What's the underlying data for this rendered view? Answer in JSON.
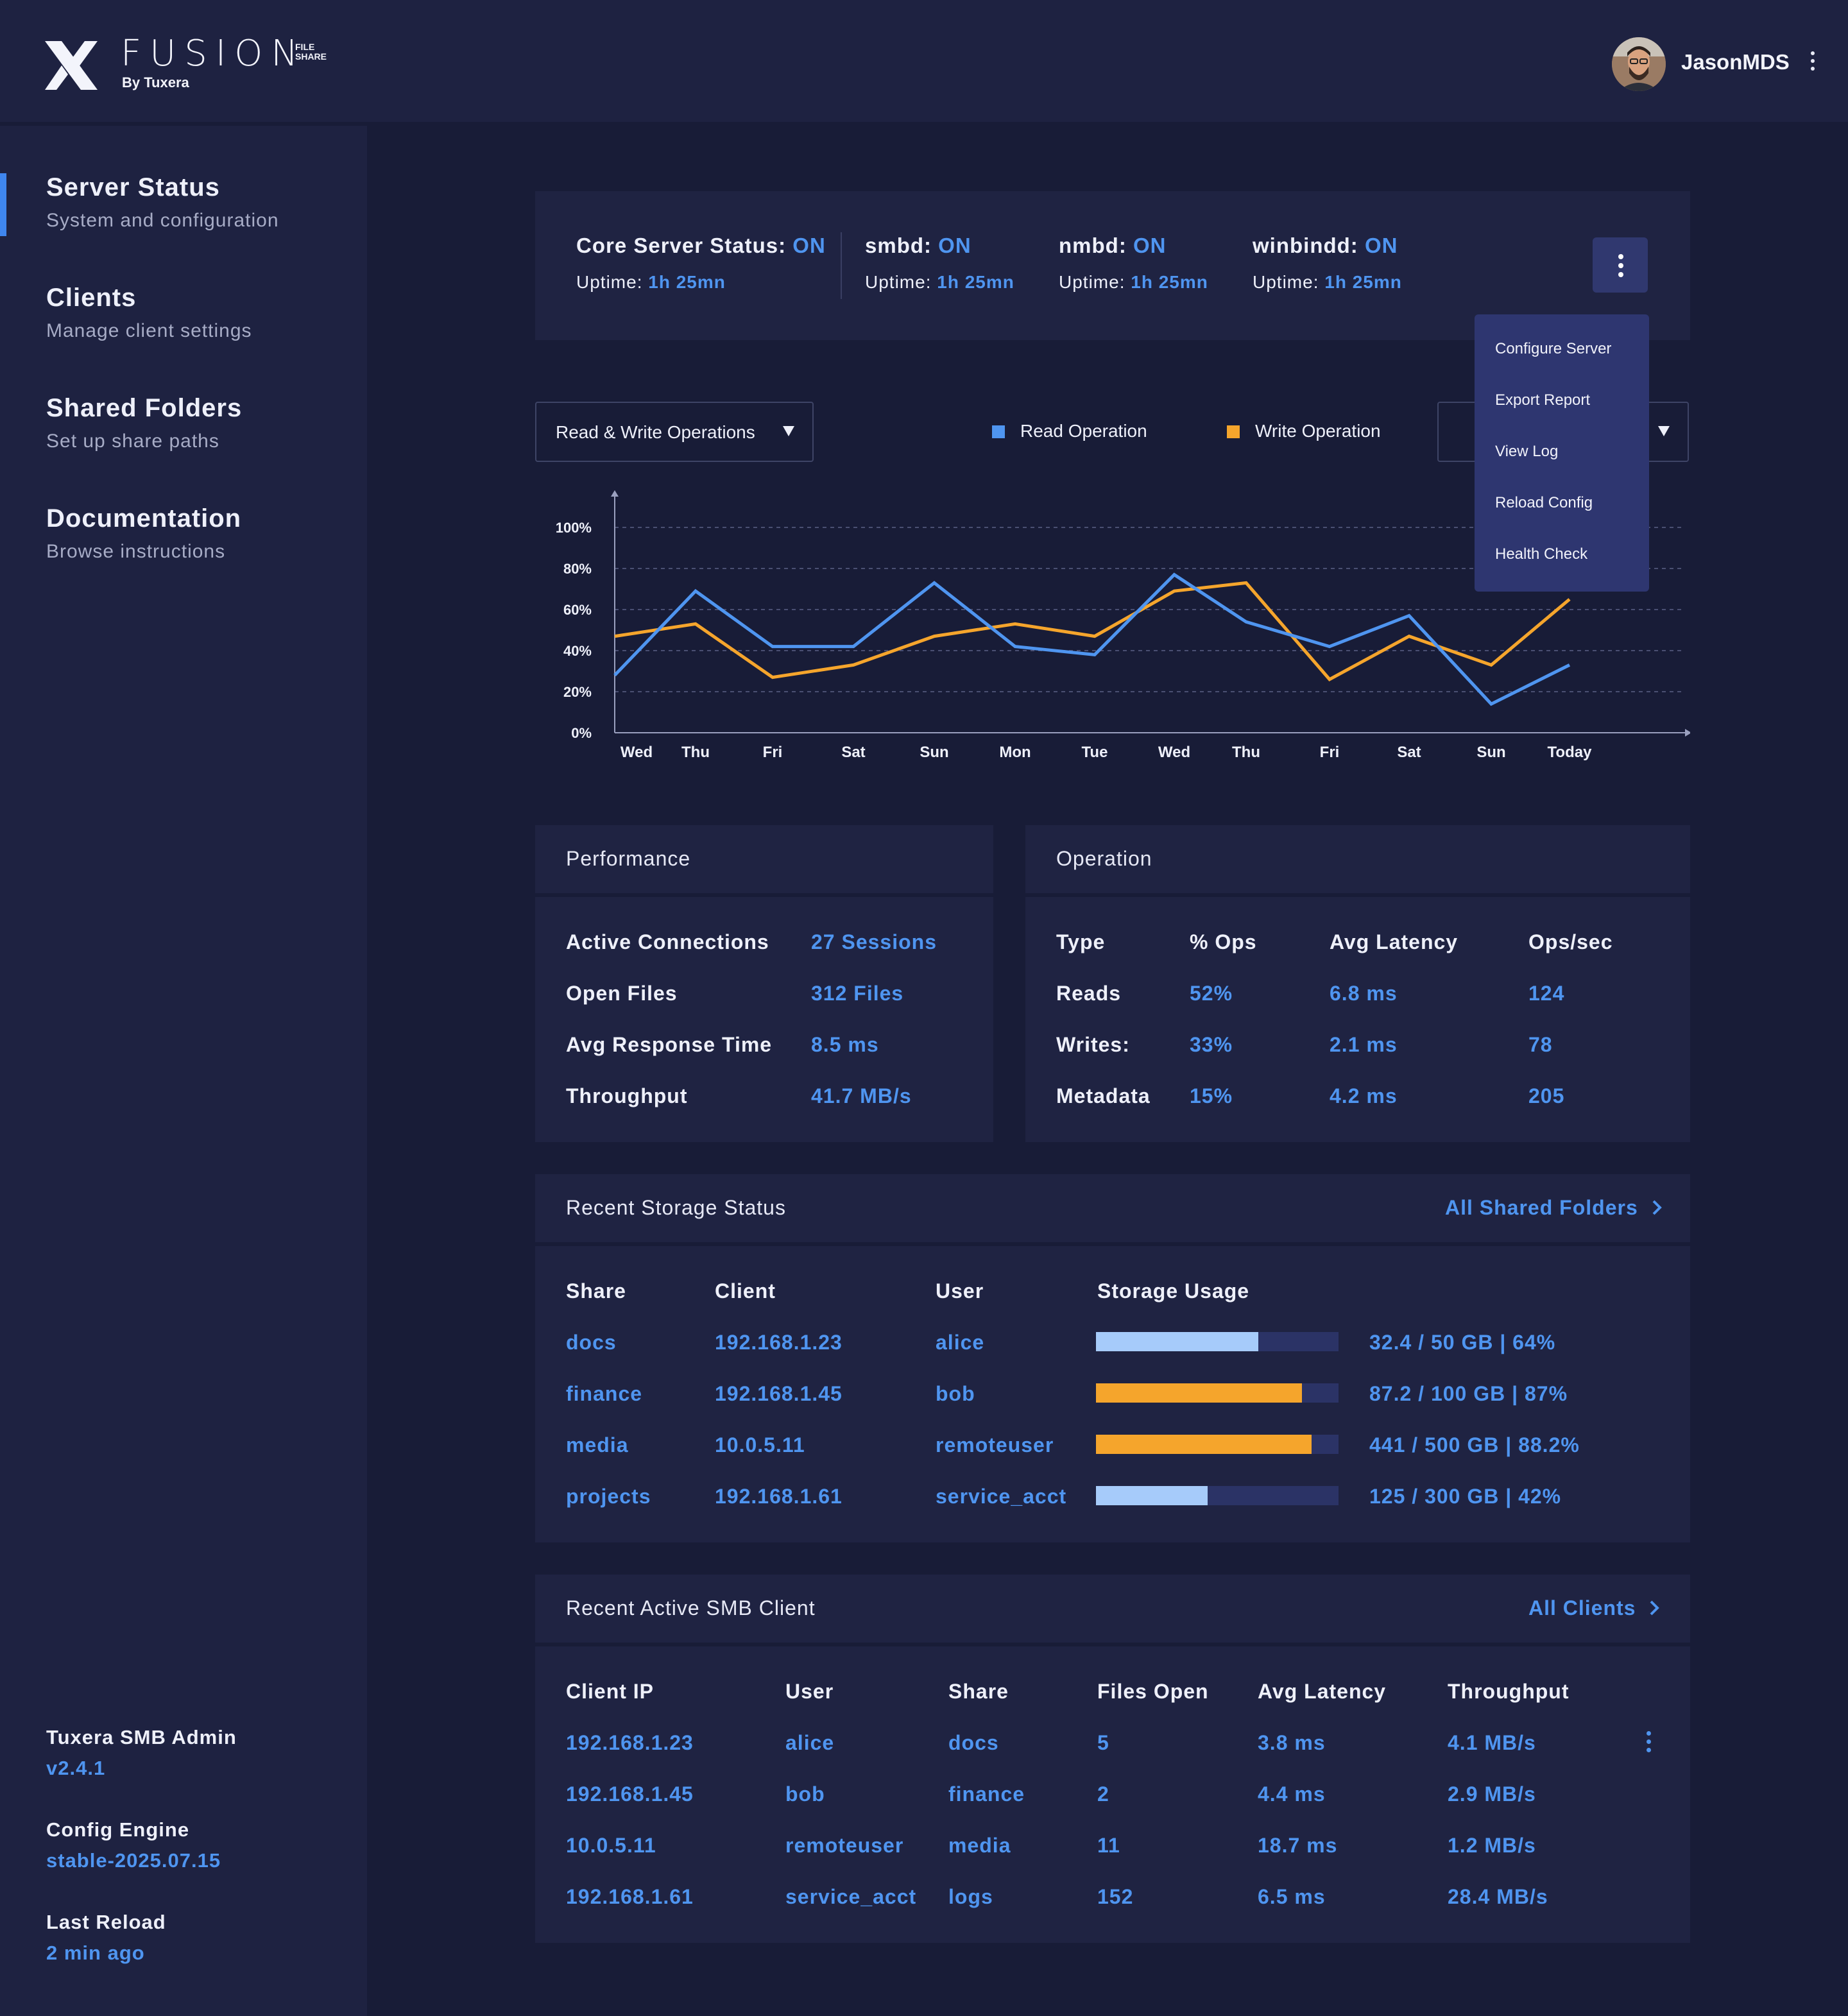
{
  "header": {
    "brand": "FUSION",
    "brand_tag_line1": "FILE",
    "brand_tag_line2": "SHARE",
    "brand_sub": "By Tuxera",
    "username": "JasonMDS"
  },
  "sidebar": {
    "items": [
      {
        "title": "Server Status",
        "subtitle": "System and configuration"
      },
      {
        "title": "Clients",
        "subtitle": "Manage client settings"
      },
      {
        "title": "Shared Folders",
        "subtitle": "Set up share paths"
      },
      {
        "title": "Documentation",
        "subtitle": "Browse instructions"
      }
    ],
    "meta": [
      {
        "label": "Tuxera SMB Admin",
        "value": "v2.4.1"
      },
      {
        "label": "Config Engine",
        "value": "stable-2025.07.15"
      },
      {
        "label": "Last Reload",
        "value": "2 min ago"
      }
    ]
  },
  "status": {
    "items": [
      {
        "name": "Core Server Status:",
        "state": "ON",
        "uptime_label": "Uptime:",
        "uptime": "1h 25mn"
      },
      {
        "name": "smbd:",
        "state": "ON",
        "uptime_label": "Uptime:",
        "uptime": "1h 25mn"
      },
      {
        "name": "nmbd:",
        "state": "ON",
        "uptime_label": "Uptime:",
        "uptime": "1h 25mn"
      },
      {
        "name": "winbindd:",
        "state": "ON",
        "uptime_label": "Uptime:",
        "uptime": "1h 25mn"
      }
    ],
    "menu": [
      "Configure Server",
      "Export Report",
      "View Log",
      "Reload Config",
      "Health Check"
    ]
  },
  "chart_controls": {
    "select_label": "Read & Write Operations",
    "legend_read": "Read Operation",
    "legend_write": "Write Operation"
  },
  "chart_data": {
    "type": "line",
    "categories": [
      "Wed",
      "Thu",
      "Fri",
      "Sat",
      "Sun",
      "Mon",
      "Tue",
      "Wed",
      "Thu",
      "Fri",
      "Sat",
      "Sun",
      "Today"
    ],
    "series": [
      {
        "name": "Read Operation",
        "color": "#4f95f0",
        "points": [
          [
            "Wed-start",
            28
          ],
          [
            "Thu",
            69
          ],
          [
            "Fri",
            42
          ],
          [
            "Sat",
            42
          ],
          [
            "Sun",
            73
          ],
          [
            "Mon",
            42
          ],
          [
            "Tue",
            38
          ],
          [
            "Wed",
            77
          ],
          [
            "Thu",
            54
          ],
          [
            "Fri",
            42
          ],
          [
            "Sat",
            57
          ],
          [
            "Sun",
            14
          ],
          [
            "Today",
            33
          ]
        ]
      },
      {
        "name": "Write Operation",
        "color": "#f5a52c",
        "points": [
          [
            "Wed-start",
            47
          ],
          [
            "Thu",
            53
          ],
          [
            "Fri",
            27
          ],
          [
            "Sat",
            33
          ],
          [
            "Sun",
            47
          ],
          [
            "Mon",
            53
          ],
          [
            "Tue",
            47
          ],
          [
            "Wed",
            69
          ],
          [
            "Thu",
            73
          ],
          [
            "Fri",
            26
          ],
          [
            "Sat",
            47
          ],
          [
            "Sun",
            33
          ],
          [
            "Today",
            65
          ]
        ]
      }
    ],
    "y_ticks": [
      "0%",
      "20%",
      "40%",
      "60%",
      "80%",
      "100%"
    ],
    "ylim": [
      0,
      100
    ],
    "grid": true,
    "legend": "top"
  },
  "performance": {
    "title": "Performance",
    "rows": [
      {
        "label": "Active Connections",
        "value": "27 Sessions"
      },
      {
        "label": "Open Files",
        "value": "312 Files"
      },
      {
        "label": "Avg Response Time",
        "value": "8.5 ms"
      },
      {
        "label": "Throughput",
        "value": "41.7 MB/s"
      }
    ]
  },
  "operation": {
    "title": "Operation",
    "headers": [
      "Type",
      "% Ops",
      "Avg Latency",
      "Ops/sec"
    ],
    "rows": [
      [
        "Reads",
        "52%",
        "6.8 ms",
        "124"
      ],
      [
        "Writes:",
        "33%",
        "2.1 ms",
        "78"
      ],
      [
        "Metadata",
        "15%",
        "4.2 ms",
        "205"
      ]
    ]
  },
  "storage": {
    "title": "Recent Storage Status",
    "link": "All Shared Folders",
    "headers": [
      "Share",
      "Client",
      "User",
      "Storage Usage"
    ],
    "rows": [
      {
        "share": "docs",
        "client": "192.168.1.23",
        "user": "alice",
        "usage": "32.4 / 50 GB | 64%",
        "fraction": 0.67,
        "color": "#a6cbfa"
      },
      {
        "share": "finance",
        "client": "192.168.1.45",
        "user": "bob",
        "usage": "87.2 / 100 GB | 87%",
        "fraction": 0.85,
        "color": "#f5a52c"
      },
      {
        "share": "media",
        "client": "10.0.5.11",
        "user": "remoteuser",
        "usage": "441 / 500 GB | 88.2%",
        "fraction": 0.89,
        "color": "#f5a52c"
      },
      {
        "share": "projects",
        "client": "192.168.1.61",
        "user": "service_acct",
        "usage": "125 / 300 GB | 42%",
        "fraction": 0.46,
        "color": "#a6cbfa"
      }
    ]
  },
  "clients": {
    "title": "Recent Active SMB Client",
    "link": "All Clients",
    "headers": [
      "Client IP",
      "User",
      "Share",
      "Files Open",
      "Avg Latency",
      "Throughput"
    ],
    "rows": [
      [
        "192.168.1.23",
        "alice",
        "docs",
        "5",
        "3.8 ms",
        "4.1 MB/s"
      ],
      [
        "192.168.1.45",
        "bob",
        "finance",
        "2",
        "4.4 ms",
        "2.9 MB/s"
      ],
      [
        "10.0.5.11",
        "remoteuser",
        "media",
        "11",
        "18.7 ms",
        "1.2 MB/s"
      ],
      [
        "192.168.1.61",
        "service_acct",
        "logs",
        "152",
        "6.5 ms",
        "28.4 MB/s"
      ]
    ]
  }
}
